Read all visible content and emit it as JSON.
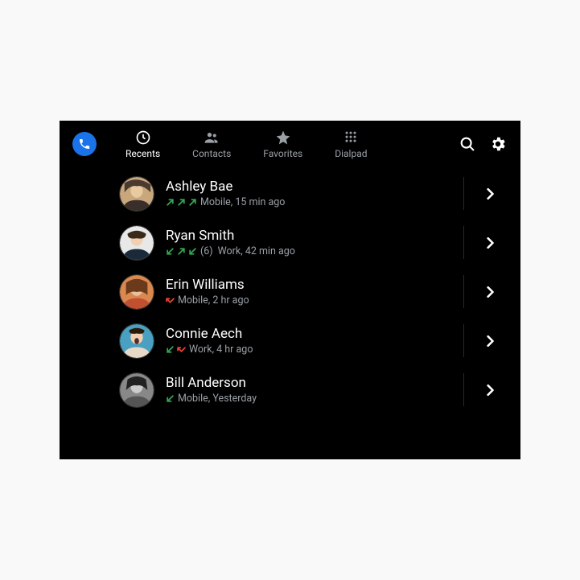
{
  "tabs": {
    "recents": "Recents",
    "contacts": "Contacts",
    "favorites": "Favorites",
    "dialpad": "Dialpad"
  },
  "calls": {
    "0": {
      "name": "Ashley Bae",
      "meta": "Mobile, 15 min ago",
      "count": ""
    },
    "1": {
      "name": "Ryan Smith",
      "meta": "Work, 42 min ago",
      "count": "(6)"
    },
    "2": {
      "name": "Erin Williams",
      "meta": "Mobile, 2 hr ago",
      "count": ""
    },
    "3": {
      "name": "Connie Aech",
      "meta": "Work, 4 hr ago",
      "count": ""
    },
    "4": {
      "name": "Bill Anderson",
      "meta": "Mobile, Yesterday",
      "count": ""
    }
  },
  "colors": {
    "outgoing": "#34a853",
    "incoming": "#34a853",
    "missed": "#ea4335",
    "muted": "#9aa0a6"
  }
}
